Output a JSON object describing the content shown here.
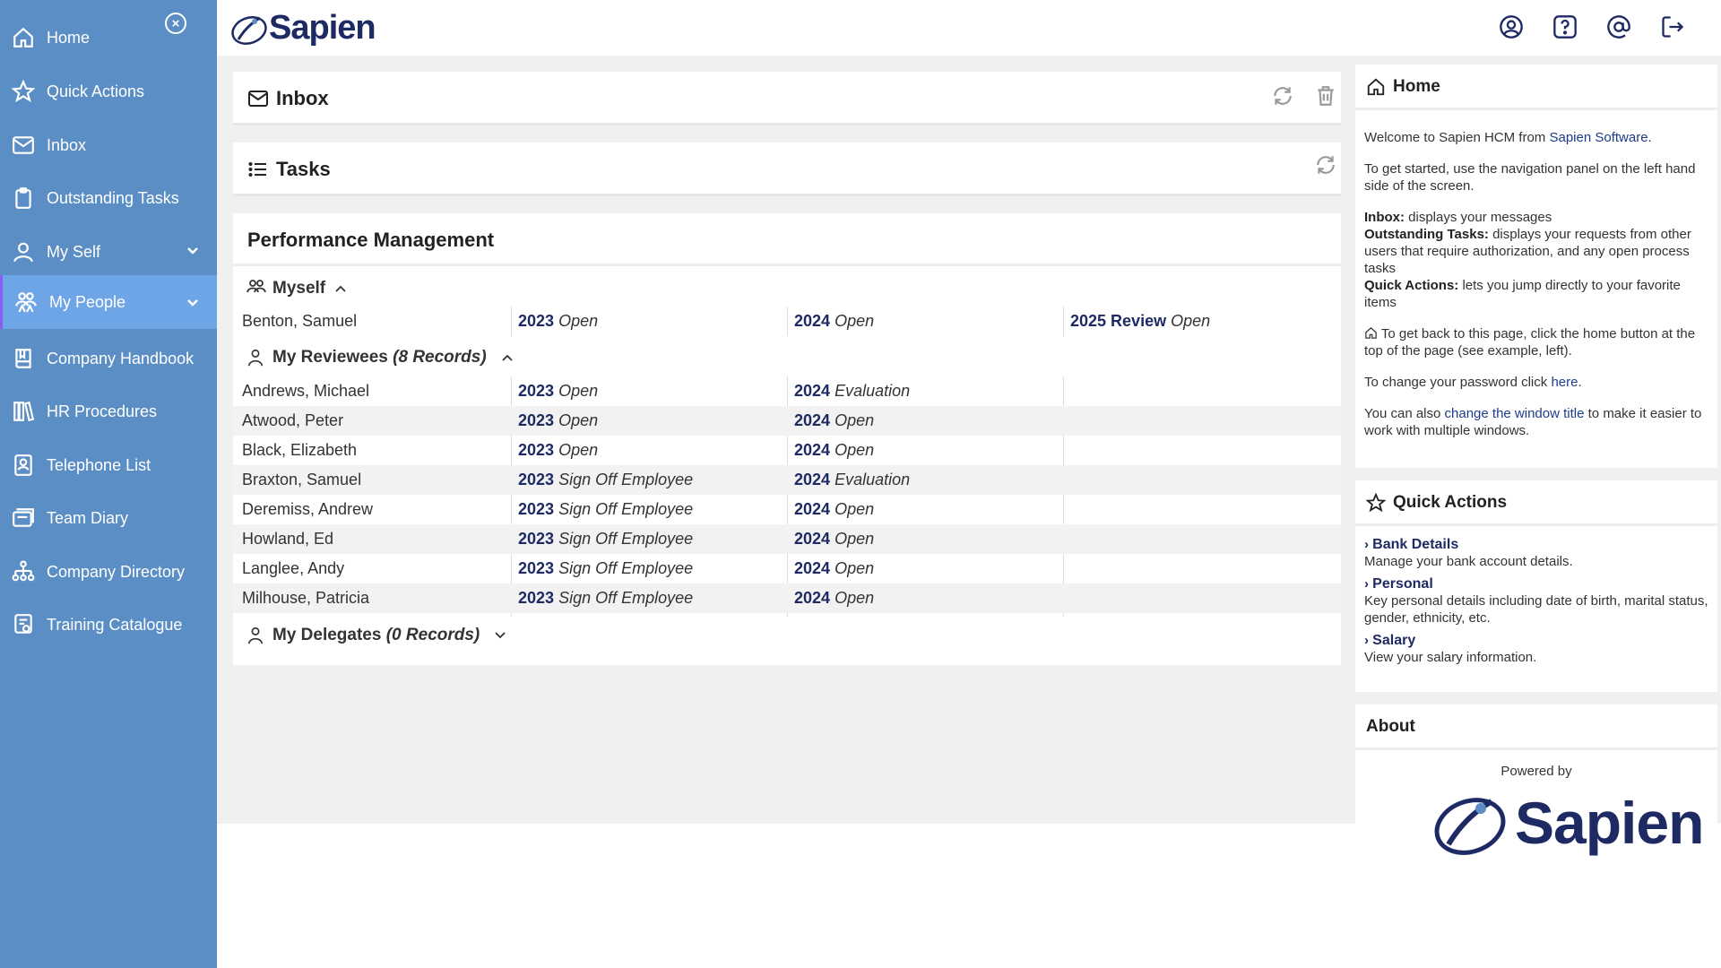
{
  "sidebar": {
    "items": [
      {
        "label": "Home",
        "icon": "home-icon"
      },
      {
        "label": "Quick Actions",
        "icon": "star-icon"
      },
      {
        "label": "Inbox",
        "icon": "mail-icon"
      },
      {
        "label": "Outstanding Tasks",
        "icon": "clipboard-icon"
      },
      {
        "label": "My Self",
        "icon": "person-icon"
      },
      {
        "label": "My People",
        "icon": "people-icon"
      },
      {
        "label": "Company Handbook",
        "icon": "book-icon"
      },
      {
        "label": "HR Procedures",
        "icon": "books-icon"
      },
      {
        "label": "Telephone List",
        "icon": "contact-card-icon"
      },
      {
        "label": "Team Diary",
        "icon": "diary-icon"
      },
      {
        "label": "Company Directory",
        "icon": "org-chart-icon"
      },
      {
        "label": "Training Catalogue",
        "icon": "certificate-icon"
      }
    ],
    "active_item": "My People"
  },
  "header": {
    "logo_text": "Sapien",
    "icons": [
      "user-circle-icon",
      "help-icon",
      "at-icon",
      "logout-icon"
    ]
  },
  "inbox": {
    "title": "Inbox"
  },
  "tasks": {
    "title": "Tasks"
  },
  "performance": {
    "title": "Performance Management",
    "myself": {
      "label": "Myself",
      "rows": [
        {
          "name": "Benton, Samuel",
          "c1_year": "2023",
          "c1_status": "Open",
          "c2_year": "2024",
          "c2_status": "Open",
          "c3_year": "2025 Review",
          "c3_status": "Open"
        }
      ]
    },
    "reviewees": {
      "label": "My Reviewees",
      "count": "(8 Records)",
      "rows": [
        {
          "name": "Andrews, Michael",
          "c1_year": "2023",
          "c1_status": "Open",
          "c2_year": "2024",
          "c2_status": "Evaluation"
        },
        {
          "name": "Atwood, Peter",
          "c1_year": "2023",
          "c1_status": "Open",
          "c2_year": "2024",
          "c2_status": "Open"
        },
        {
          "name": "Black, Elizabeth",
          "c1_year": "2023",
          "c1_status": "Open",
          "c2_year": "2024",
          "c2_status": "Open"
        },
        {
          "name": "Braxton, Samuel",
          "c1_year": "2023",
          "c1_status": "Sign Off Employee",
          "c2_year": "2024",
          "c2_status": "Evaluation"
        },
        {
          "name": "Deremiss, Andrew",
          "c1_year": "2023",
          "c1_status": "Sign Off Employee",
          "c2_year": "2024",
          "c2_status": "Open"
        },
        {
          "name": "Howland, Ed",
          "c1_year": "2023",
          "c1_status": "Sign Off Employee",
          "c2_year": "2024",
          "c2_status": "Open"
        },
        {
          "name": "Langlee, Andy",
          "c1_year": "2023",
          "c1_status": "Sign Off Employee",
          "c2_year": "2024",
          "c2_status": "Open"
        },
        {
          "name": "Milhouse, Patricia",
          "c1_year": "2023",
          "c1_status": "Sign Off Employee",
          "c2_year": "2024",
          "c2_status": "Open"
        }
      ]
    },
    "delegates": {
      "label": "My Delegates",
      "count": "(0 Records)"
    }
  },
  "right_home": {
    "title": "Home",
    "welcome_pre": "Welcome to Sapien HCM from ",
    "welcome_link": "Sapien Software",
    "welcome_post": ".",
    "getting_started": "To get started, use the navigation panel on the left hand side of the screen.",
    "inbox_label": "Inbox:",
    "inbox_desc": " displays your messages",
    "tasks_label": "Outstanding Tasks:",
    "tasks_desc": " displays your requests from other users that require authorization, and any open process tasks",
    "qa_label": "Quick Actions:",
    "qa_desc": " lets you jump directly to your favorite items",
    "home_back": "To get back to this page, click the home button at the top of the page (see example, left).",
    "password_pre": "To change your password click ",
    "password_link": "here",
    "password_post": ".",
    "window_pre": "You can also ",
    "window_link": "change the window title",
    "window_post": " to make it easier to work with multiple windows."
  },
  "right_qa": {
    "title": "Quick Actions",
    "items": [
      {
        "label": "Bank Details",
        "desc": "Manage your bank account details."
      },
      {
        "label": "Personal",
        "desc": "Key personal details including date of birth, marital status, gender, ethnicity, etc."
      },
      {
        "label": "Salary",
        "desc": "View your salary information."
      }
    ]
  },
  "right_about": {
    "title": "About",
    "powered_by": "Powered by",
    "logo_text": "Sapien"
  },
  "colors": {
    "sidebar_bg": "#5b8ec4",
    "sidebar_active": "#6ea5e6",
    "brand_navy": "#1d2a63"
  }
}
